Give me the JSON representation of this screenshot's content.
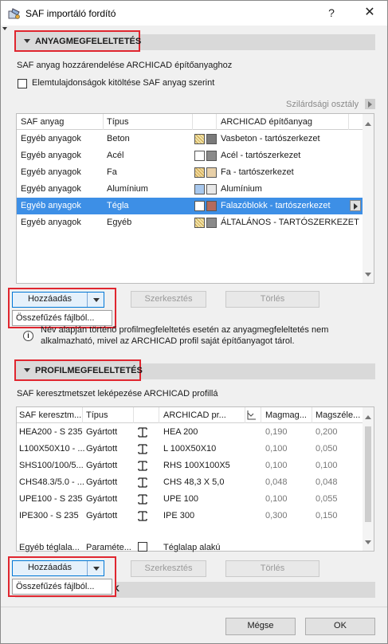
{
  "window": {
    "title": "SAF importáló fordító",
    "help_label": "?",
    "close_label": "✕"
  },
  "material_section": {
    "header": "ANYAGMEGFELELTETÉS",
    "description": "SAF anyag hozzárendelése ARCHICAD építőanyaghoz",
    "checkbox_label": "Elemtulajdonságok kitöltése SAF anyag szerint",
    "checkbox_checked": false,
    "strength_class_label": "Szilárdsági osztály",
    "columns": [
      "SAF anyag",
      "Típus",
      "ARCHICAD építőanyag"
    ],
    "rows": [
      {
        "saf": "Egyéb anyagok",
        "type": "Beton",
        "ac": "Vasbeton - tartószerkezet",
        "swatch1": "#f1e3a8",
        "swatch2": "#7a7a7a",
        "selected": false
      },
      {
        "saf": "Egyéb anyagok",
        "type": "Acél",
        "ac": "Acél - tartószerkezet",
        "swatch1": "#ffffff",
        "swatch2": "#8a8a8a",
        "selected": false
      },
      {
        "saf": "Egyéb anyagok",
        "type": "Fa",
        "ac": "Fa - tartószerkezet",
        "swatch1": "#f1d89a",
        "swatch2": "#e8d0a8",
        "selected": false
      },
      {
        "saf": "Egyéb anyagok",
        "type": "Alumínium",
        "ac": "Alumínium",
        "swatch1": "#a8c8ee",
        "swatch2": "#e8e8e8",
        "selected": false
      },
      {
        "saf": "Egyéb anyagok",
        "type": "Tégla",
        "ac": "Falazóblokk - tartószerkezet",
        "swatch1": "#ffffff",
        "swatch2": "#b46a5c",
        "selected": true
      },
      {
        "saf": "Egyéb anyagok",
        "type": "Egyéb",
        "ac": "ÁLTALÁNOS - TARTÓSZERKEZET",
        "swatch1": "#f1e3a8",
        "swatch2": "#8a8a8a",
        "selected": false
      }
    ],
    "add_label": "Hozzáadás",
    "dropdown_item": "Összefűzés fájlból...",
    "edit_label": "Szerkesztés",
    "delete_label": "Törlés",
    "info_text_1": "Név alapján történő profilmegfeleltetés esetén az anyagmegfeleltetés nem",
    "info_text_2": "alkalmazható, mivel az ARCHICAD profil saját építőanyagot tárol."
  },
  "profile_section": {
    "header": "PROFILMEGFELELTETÉS",
    "description": "SAF keresztmetszet leképezése ARCHICAD profillá",
    "columns": [
      "SAF keresztm...",
      "Típus",
      "ARCHICAD pr...",
      "Magmag...",
      "Magszéle..."
    ],
    "rows": [
      {
        "saf": "HEA200 - S 235",
        "type": "Gyártott",
        "ac": "HEA 200",
        "h": "0,190",
        "w": "0,200"
      },
      {
        "saf": "L100X50X10 - ...",
        "type": "Gyártott",
        "ac": "L 100X50X10",
        "h": "0,100",
        "w": "0,050"
      },
      {
        "saf": "SHS100/100/5...",
        "type": "Gyártott",
        "ac": "RHS 100X100X5",
        "h": "0,100",
        "w": "0,100"
      },
      {
        "saf": "CHS48.3/5.0 - ...",
        "type": "Gyártott",
        "ac": "CHS 48,3 X 5,0",
        "h": "0,048",
        "w": "0,048"
      },
      {
        "saf": "UPE100 - S 235",
        "type": "Gyártott",
        "ac": "UPE 100",
        "h": "0,100",
        "w": "0,055"
      },
      {
        "saf": "IPE300 - S 235",
        "type": "Gyártott",
        "ac": "IPE 300",
        "h": "0,300",
        "w": "0,150"
      }
    ],
    "extra_row": {
      "saf": "Egyéb téglala...",
      "type": "Paraméte...",
      "ac": "Téglalap alakú"
    },
    "add_label": "Hozzáadás",
    "dropdown_item": "Összefűzés fájlból...",
    "edit_label": "Szerkesztés",
    "delete_label": "Törlés",
    "partial_header_char": "K"
  },
  "footer": {
    "cancel_label": "Mégse",
    "ok_label": "OK"
  },
  "colors": {
    "highlight": "#e0262f",
    "selection": "#3d8fe6"
  }
}
